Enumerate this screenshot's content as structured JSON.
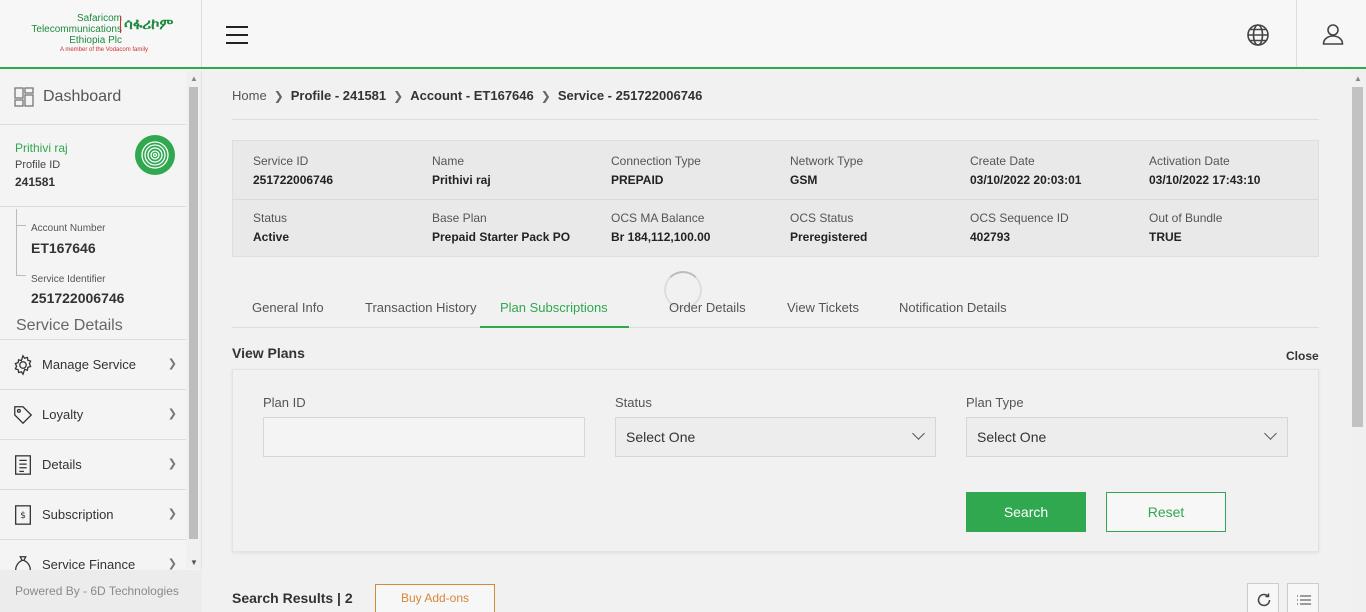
{
  "header": {
    "logo_line1": "Safaricom",
    "logo_line2": "Telecommunications",
    "logo_line3": "Ethiopia Plc",
    "logo_amharic": "ሳፋሪኮም",
    "logo_tagline": "A member of the Vodacom family"
  },
  "sidebar": {
    "dashboard_label": "Dashboard",
    "profile_name": "Prithivi raj",
    "profile_id_label": "Profile ID",
    "profile_id": "241581",
    "account_number_label": "Account Number",
    "account_number": "ET167646",
    "service_identifier_label": "Service Identifier",
    "service_identifier": "251722006746",
    "service_details_title": "Service Details",
    "menu": [
      {
        "label": "Manage Service",
        "icon": "gear-icon"
      },
      {
        "label": "Loyalty",
        "icon": "tag-icon"
      },
      {
        "label": "Details",
        "icon": "document-icon"
      },
      {
        "label": "Subscription",
        "icon": "receipt-icon"
      },
      {
        "label": "Service Finance",
        "icon": "money-bag-icon"
      }
    ],
    "powered_by": "Powered By - 6D Technologies"
  },
  "breadcrumb": {
    "home": "Home",
    "profile": "Profile - 241581",
    "account": "Account - ET167646",
    "service": "Service - 251722006746"
  },
  "service_info": {
    "row1": [
      {
        "label": "Service ID",
        "value": "251722006746"
      },
      {
        "label": "Name",
        "value": "Prithivi raj"
      },
      {
        "label": "Connection Type",
        "value": "PREPAID"
      },
      {
        "label": "Network Type",
        "value": "GSM"
      },
      {
        "label": "Create Date",
        "value": "03/10/2022 20:03:01"
      },
      {
        "label": "Activation Date",
        "value": "03/10/2022 17:43:10"
      }
    ],
    "row2": [
      {
        "label": "Status",
        "value": "Active"
      },
      {
        "label": "Base Plan",
        "value": "Prepaid Starter Pack PO"
      },
      {
        "label": "OCS MA Balance",
        "value": "Br 184,112,100.00"
      },
      {
        "label": "OCS Status",
        "value": "Preregistered"
      },
      {
        "label": "OCS Sequence ID",
        "value": "402793"
      },
      {
        "label": "Out of Bundle",
        "value": "TRUE"
      }
    ]
  },
  "tabs": [
    {
      "label": "General Info"
    },
    {
      "label": "Transaction History"
    },
    {
      "label": "Plan Subscriptions",
      "active": true
    },
    {
      "label": "Order Details"
    },
    {
      "label": "View Tickets"
    },
    {
      "label": "Notification Details"
    }
  ],
  "view_plans": {
    "title": "View Plans",
    "close": "Close",
    "plan_id_label": "Plan ID",
    "plan_id_value": "",
    "status_label": "Status",
    "status_value": "Select One",
    "plan_type_label": "Plan Type",
    "plan_type_value": "Select One",
    "search_button": "Search",
    "reset_button": "Reset"
  },
  "results": {
    "title": "Search Results | 2",
    "buy_addons": "Buy Add-ons"
  },
  "colors": {
    "accent": "#2fa84f",
    "addon": "#d4883a"
  }
}
